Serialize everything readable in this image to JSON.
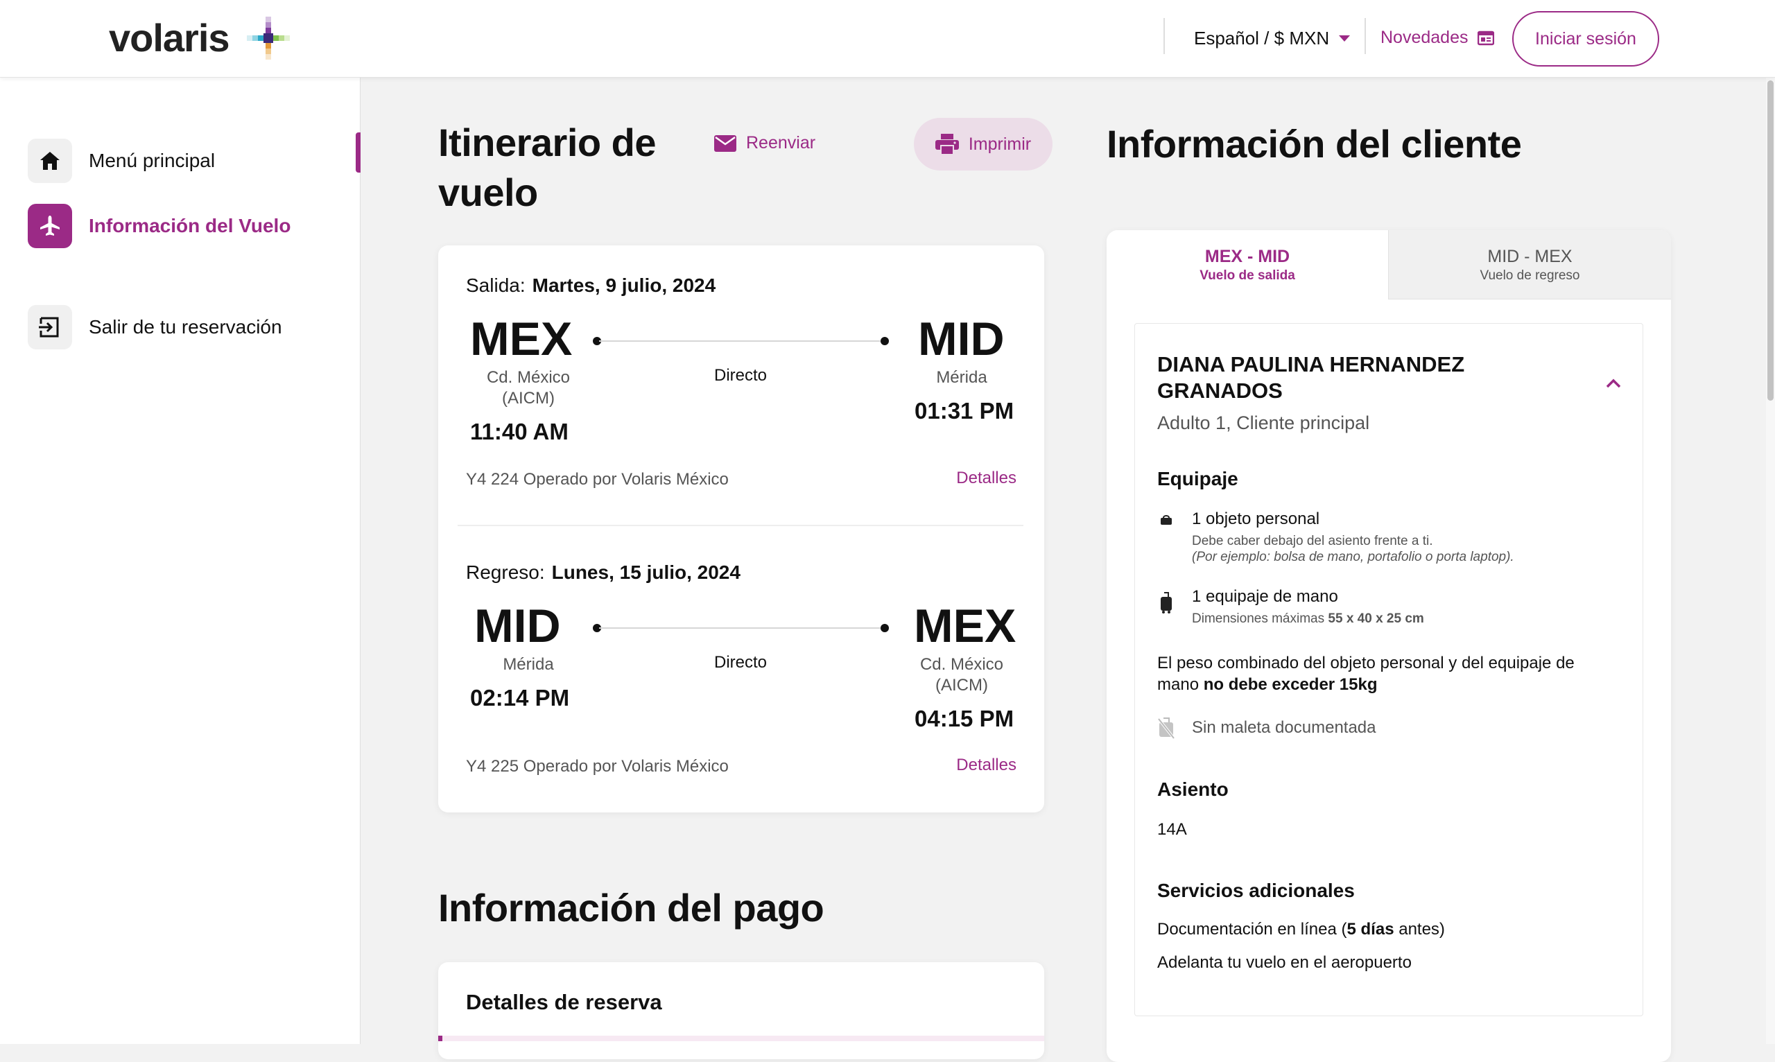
{
  "header": {
    "logo_text": "volaris",
    "language_currency": "Español / $ MXN",
    "novedades": "Novedades",
    "login": "Iniciar sesión"
  },
  "sidebar": {
    "items": [
      {
        "label": "Menú principal",
        "icon": "home-icon"
      },
      {
        "label": "Información del Vuelo",
        "icon": "airplane-icon",
        "active": true
      },
      {
        "label": "Salir de tu reservación",
        "icon": "exit-icon"
      }
    ]
  },
  "itinerary": {
    "title_line1": "Itinerario de",
    "title_line2": "vuelo",
    "resend": "Reenviar",
    "print": "Imprimir",
    "legs": [
      {
        "date_label": "Salida:",
        "date": "Martes, 9 julio, 2024",
        "origin_code": "MEX",
        "origin_city_line1": "Cd. México",
        "origin_city_line2": "(AICM)",
        "origin_time": "11:40 AM",
        "dest_code": "MID",
        "dest_city_line1": "Mérida",
        "dest_city_line2": "",
        "dest_time": "01:31 PM",
        "stops": "Directo",
        "flight": "Y4 224  Operado por Volaris México",
        "details": "Detalles"
      },
      {
        "date_label": "Regreso:",
        "date": "Lunes, 15 julio, 2024",
        "origin_code": "MID",
        "origin_city_line1": "Mérida",
        "origin_city_line2": "",
        "origin_time": "02:14 PM",
        "dest_code": "MEX",
        "dest_city_line1": "Cd. México",
        "dest_city_line2": "(AICM)",
        "dest_time": "04:15 PM",
        "stops": "Directo",
        "flight": "Y4 225  Operado por Volaris México",
        "details": "Detalles"
      }
    ]
  },
  "payment": {
    "title": "Información del pago",
    "card_title": "Detalles de reserva"
  },
  "client": {
    "title": "Información del cliente",
    "tabs": [
      {
        "route": "MEX - MID",
        "sub": "Vuelo de salida",
        "active": true
      },
      {
        "route": "MID - MEX",
        "sub": "Vuelo de regreso",
        "active": false
      }
    ],
    "passenger": {
      "name": "DIANA PAULINA HERNANDEZ GRANADOS",
      "type": "Adulto 1, Cliente principal"
    },
    "baggage": {
      "title": "Equipaje",
      "personal_item": "1 objeto personal",
      "personal_desc": "Debe caber debajo del asiento frente a ti.",
      "personal_example": "(Por ejemplo: bolsa de mano, portafolio o porta laptop).",
      "carry_on": "1 equipaje de mano",
      "carry_on_dims_label": "Dimensiones máximas",
      "carry_on_dims": "55 x 40 x 25 cm",
      "combined_text": "El peso combinado del objeto personal y del equipaje de mano",
      "combined_bold": "no debe exceder 15kg",
      "checked": "Sin maleta documentada"
    },
    "seat": {
      "title": "Asiento",
      "value": "14A"
    },
    "extras": {
      "title": "Servicios adicionales",
      "online_doc_prefix": "Documentación en línea (",
      "online_doc_bold": "5 días",
      "online_doc_suffix": " antes)",
      "advance_flight": "Adelanta tu vuelo en el aeropuerto"
    }
  },
  "colors": {
    "brand": "#9b2a86",
    "page_bg": "#f2f2f2",
    "tab_inactive_bg": "#f0f0f0"
  }
}
